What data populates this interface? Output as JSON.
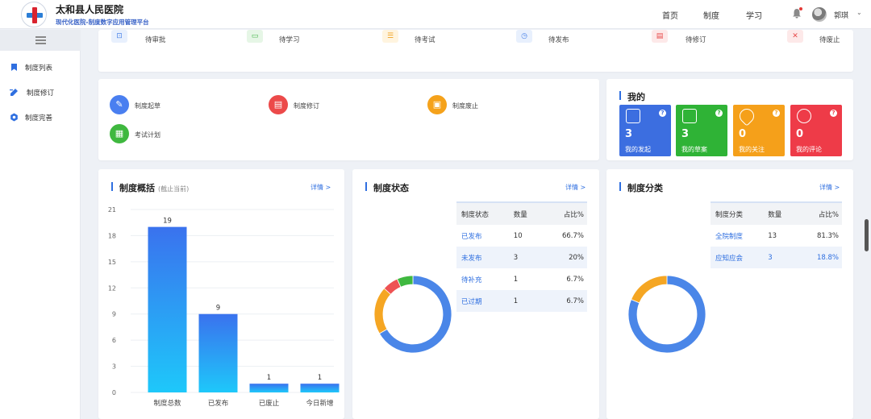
{
  "header": {
    "title": "太和县人民医院",
    "subtitle": "现代化医院-制度数字应用管理平台",
    "nav": [
      "首页",
      "制度",
      "学习"
    ],
    "user_name": "郭琪",
    "caret": "⌄"
  },
  "sidebar": {
    "items": [
      {
        "icon": "bookmark-icon",
        "label": "制度列表"
      },
      {
        "icon": "edit-icon",
        "label": "制度修订"
      },
      {
        "icon": "gear-icon",
        "label": "制度完善"
      }
    ]
  },
  "todo": {
    "items": [
      {
        "icon": "approval-icon",
        "label": "待审批",
        "color": "#4a83e8",
        "bg": "#e8f0fd"
      },
      {
        "icon": "book-icon",
        "label": "待学习",
        "color": "#44b548",
        "bg": "#e6f6e6"
      },
      {
        "icon": "exam-icon",
        "label": "待考试",
        "color": "#f0a020",
        "bg": "#fff4df"
      },
      {
        "icon": "publish-icon",
        "label": "待发布",
        "color": "#4a83e8",
        "bg": "#e8f0fd"
      },
      {
        "icon": "revise-icon",
        "label": "待修订",
        "color": "#e84a4a",
        "bg": "#fde9e9"
      },
      {
        "icon": "abolish-icon",
        "label": "待废止",
        "color": "#e84a4a",
        "bg": "#fde9e9"
      }
    ]
  },
  "actions": [
    {
      "icon": "draft-icon",
      "label": "制度起草",
      "color": "#4a7ff0"
    },
    {
      "icon": "revise-icon",
      "label": "制度修订",
      "color": "#ec4a4a"
    },
    {
      "icon": "abolish-icon",
      "label": "制度废止",
      "color": "#f5a21b"
    },
    {
      "icon": "exam-plan-icon",
      "label": "考试计划",
      "color": "#3fb83f"
    }
  ],
  "mine": {
    "title": "我的",
    "tiles": [
      {
        "icon": "initiate-icon",
        "value": "3",
        "label": "我的发起",
        "color": "#3c6ee0"
      },
      {
        "icon": "draft-box-icon",
        "value": "3",
        "label": "我的草案",
        "color": "#2fb336"
      },
      {
        "icon": "heart-icon",
        "value": "0",
        "label": "我的关注",
        "color": "#f5a01a"
      },
      {
        "icon": "comment-icon",
        "value": "0",
        "label": "我的评论",
        "color": "#ee3b48"
      }
    ],
    "q_mark": "?"
  },
  "overview": {
    "title": "制度概括",
    "subtitle": "(截止当前)",
    "detail": "详情 >"
  },
  "status": {
    "title": "制度状态",
    "detail": "详情 >",
    "headers": [
      "制度状态",
      "数量",
      "占比%"
    ],
    "rows": [
      {
        "name": "已发布",
        "count": "10",
        "pct": "66.7%"
      },
      {
        "name": "未发布",
        "count": "3",
        "pct": "20%"
      },
      {
        "name": "待补充",
        "count": "1",
        "pct": "6.7%"
      },
      {
        "name": "已过期",
        "count": "1",
        "pct": "6.7%"
      }
    ]
  },
  "category": {
    "title": "制度分类",
    "detail": "详情 >",
    "headers": [
      "制度分类",
      "数量",
      "占比%"
    ],
    "rows": [
      {
        "name": "全院制度",
        "count": "13",
        "pct": "81.3%"
      },
      {
        "name": "应知应会",
        "count": "3",
        "pct": "18.8%"
      }
    ]
  },
  "chart_data": [
    {
      "type": "bar",
      "categories": [
        "制度总数",
        "已发布",
        "已废止",
        "今日新增"
      ],
      "values": [
        19,
        9,
        1,
        1
      ],
      "ylim": [
        0,
        21
      ],
      "yticks": [
        0,
        3,
        6,
        9,
        12,
        15,
        18,
        21
      ],
      "grid": true,
      "colors": [
        "#1ec8fa",
        "#3a72ee"
      ]
    },
    {
      "type": "pie",
      "labels": [
        "已发布",
        "未发布",
        "待补充",
        "已过期"
      ],
      "values": [
        10,
        3,
        1,
        1
      ],
      "colors": [
        "#4a86e8",
        "#f5a623",
        "#ee5253",
        "#3fb83f"
      ]
    },
    {
      "type": "pie",
      "labels": [
        "全院制度",
        "应知应会"
      ],
      "values": [
        13,
        3
      ],
      "colors": [
        "#4a86e8",
        "#f5a623"
      ]
    }
  ]
}
